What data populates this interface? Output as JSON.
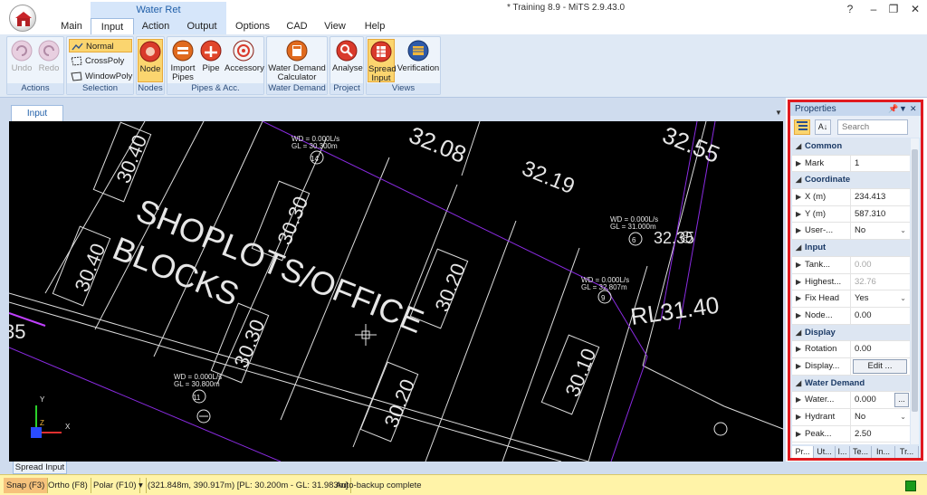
{
  "window": {
    "title": "* Training 8.9 - MiTS 2.9.43.0",
    "context_group": "Water Ret",
    "help": "?",
    "minimize": "–",
    "restore": "❐",
    "close": "✕"
  },
  "ribbon_tabs": [
    "Main",
    "Input",
    "Action",
    "Output",
    "Options",
    "CAD",
    "View",
    "Help"
  ],
  "ribbon": {
    "actions": {
      "label": "Actions",
      "undo": "Undo",
      "redo": "Redo"
    },
    "selection": {
      "label": "Selection",
      "normal": "Normal",
      "crosspoly": "CrossPoly",
      "windowpoly": "WindowPoly"
    },
    "nodes": {
      "label": "Nodes",
      "node": "Node"
    },
    "pipes": {
      "label": "Pipes & Acc.",
      "import": "Import Pipes",
      "import_l1": "Import",
      "import_l2": "Pipes",
      "pipe": "Pipe",
      "accessory": "Accessory"
    },
    "water_demand": {
      "label": "Water Demand",
      "calc_l1": "Water Demand",
      "calc_l2": "Calculator"
    },
    "project": {
      "label": "Project",
      "analyse": "Analyse"
    },
    "views": {
      "label": "Views",
      "spread_l1": "Spread",
      "spread_l2": "Input",
      "verification": "Verification"
    }
  },
  "document_tab": "Input",
  "bottom_tab": "Spread Input",
  "status": {
    "snap": "Snap (F3)",
    "ortho": "Ortho (F8)",
    "polar": "Polar (F10)",
    "coords": "(321.848m, 390.917m) [PL: 30.200m - GL: 31.983m]",
    "backup": "Auto-backup complete",
    "indicator_color": "#1a9a1a"
  },
  "properties": {
    "title": "Properties",
    "search_placeholder": "Search",
    "sections": [
      {
        "name": "Common",
        "rows": [
          {
            "label": "Mark",
            "value": "1"
          }
        ]
      },
      {
        "name": "Coordinate",
        "rows": [
          {
            "label": "X (m)",
            "value": "234.413"
          },
          {
            "label": "Y (m)",
            "value": "587.310"
          },
          {
            "label": "User-...",
            "value": "No"
          }
        ]
      },
      {
        "name": "Input",
        "rows": [
          {
            "label": "Tank...",
            "value": "0.00"
          },
          {
            "label": "Highest...",
            "value": "32.76"
          },
          {
            "label": "Fix Head",
            "value": "Yes"
          },
          {
            "label": "Node...",
            "value": "0.00"
          }
        ]
      },
      {
        "name": "Display",
        "rows": [
          {
            "label": "Rotation",
            "value": "0.00"
          },
          {
            "label": "Display...",
            "value": "Edit ..."
          }
        ]
      },
      {
        "name": "Water Demand",
        "rows": [
          {
            "label": "Water...",
            "value": "0.000"
          },
          {
            "label": "Hydrant",
            "value": "No"
          },
          {
            "label": "Peak...",
            "value": "2.50"
          }
        ]
      }
    ],
    "bottom_tabs": [
      "Pr...",
      "Ut...",
      "I...",
      "Te...",
      "In...",
      "Tr..."
    ]
  },
  "cad": {
    "title_lines": [
      "SHOPLOTS/OFFICE",
      "BLOCKS"
    ],
    "plot_labels": [
      "30.40",
      "30.30",
      "30.40",
      "30.20",
      "30.30",
      "30.10",
      "30.20"
    ],
    "level_labels": [
      "32.08",
      "32.55",
      "32.19",
      "RL31.40"
    ],
    "partial_label": "35",
    "node_labels": [
      "14",
      "6",
      "9",
      "11"
    ],
    "node_annotations": [
      {
        "wd": "WD = 0.000L/s",
        "gl": "GL = 30.300m"
      },
      {
        "wd": "WD = 0.000L/s",
        "gl": "GL = 32.807m"
      },
      {
        "wd": "WD = 0.000L/s",
        "gl": "GL = 30.800m"
      },
      {
        "wd": "WD = 0.000L/s",
        "gl": "GL = 31.000m"
      }
    ],
    "node_tail": "32.35",
    "node_tail2": "6",
    "axis_y": "Y",
    "axis_x": "X"
  }
}
